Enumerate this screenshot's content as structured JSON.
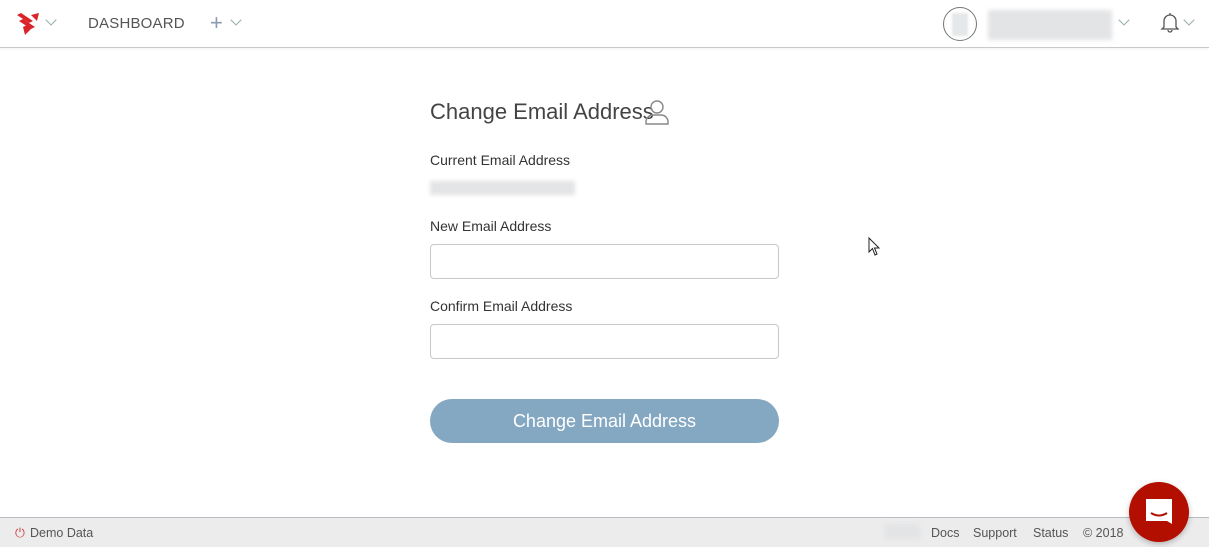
{
  "header": {
    "nav_dashboard": "DASHBOARD"
  },
  "form": {
    "title": "Change Email Address",
    "current_label": "Current Email Address",
    "new_label": "New Email Address",
    "new_value": "",
    "confirm_label": "Confirm Email Address",
    "confirm_value": "",
    "submit_label": "Change Email Address"
  },
  "footer": {
    "demo": "Demo Data",
    "links": [
      "Docs",
      "Support",
      "Status"
    ],
    "copyright": "© 2018"
  },
  "colors": {
    "brand": "#d8252c",
    "button": "#84a7c2",
    "chat": "#b30f00"
  }
}
